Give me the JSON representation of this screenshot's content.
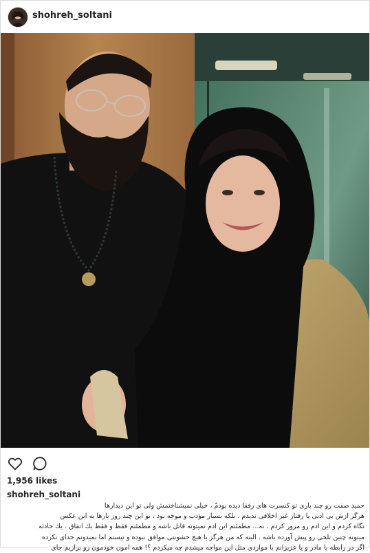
{
  "header": {
    "username": "shohreh_soltani"
  },
  "post": {
    "image_alt": "Bearded man with glasses and a smiling woman in a black headscarf and beige coat posing together",
    "actions": {
      "like_icon": "heart-icon",
      "comment_icon": "comment-icon"
    },
    "likes": "1,956 likes",
    "caption": {
      "username": "shohreh_soltani",
      "lines": [
        "حمید صفت رو چند باری تو کنسرت های رفقا دیده بودمّ ، خیلی نمیشناختمش ولی تو این دیدارها",
        "هرگز ازش بی ادبی یا رفتار غیر اخلاقی ندیدم . بلکه بسیار مؤدب و موجه بود . تو این چند روز بارها به این عکس",
        "نگاه کردم و این ادم رو مرور کردم . نه... مطمئنم این ادم نمیتونه قاتل باشه و مطمئنم فقط و فقط یك اتفاق . یك حادثه",
        "میتونه چنین تلخی رو پیش آورده باشه . البته که من هرگز با هیچ خشونتی موافق نبوده و نیستم اما نمیدونم خدای نکرده",
        "اگر در رابطه با مادر و یا عزیزانم با مواردی مثل این مواجه میشدم چه میکردم ؟! همه امون خودمون رو بزاریم جای"
      ]
    }
  },
  "colors": {
    "text": "#262626",
    "border": "#dbdbdb",
    "background": "#ffffff"
  }
}
